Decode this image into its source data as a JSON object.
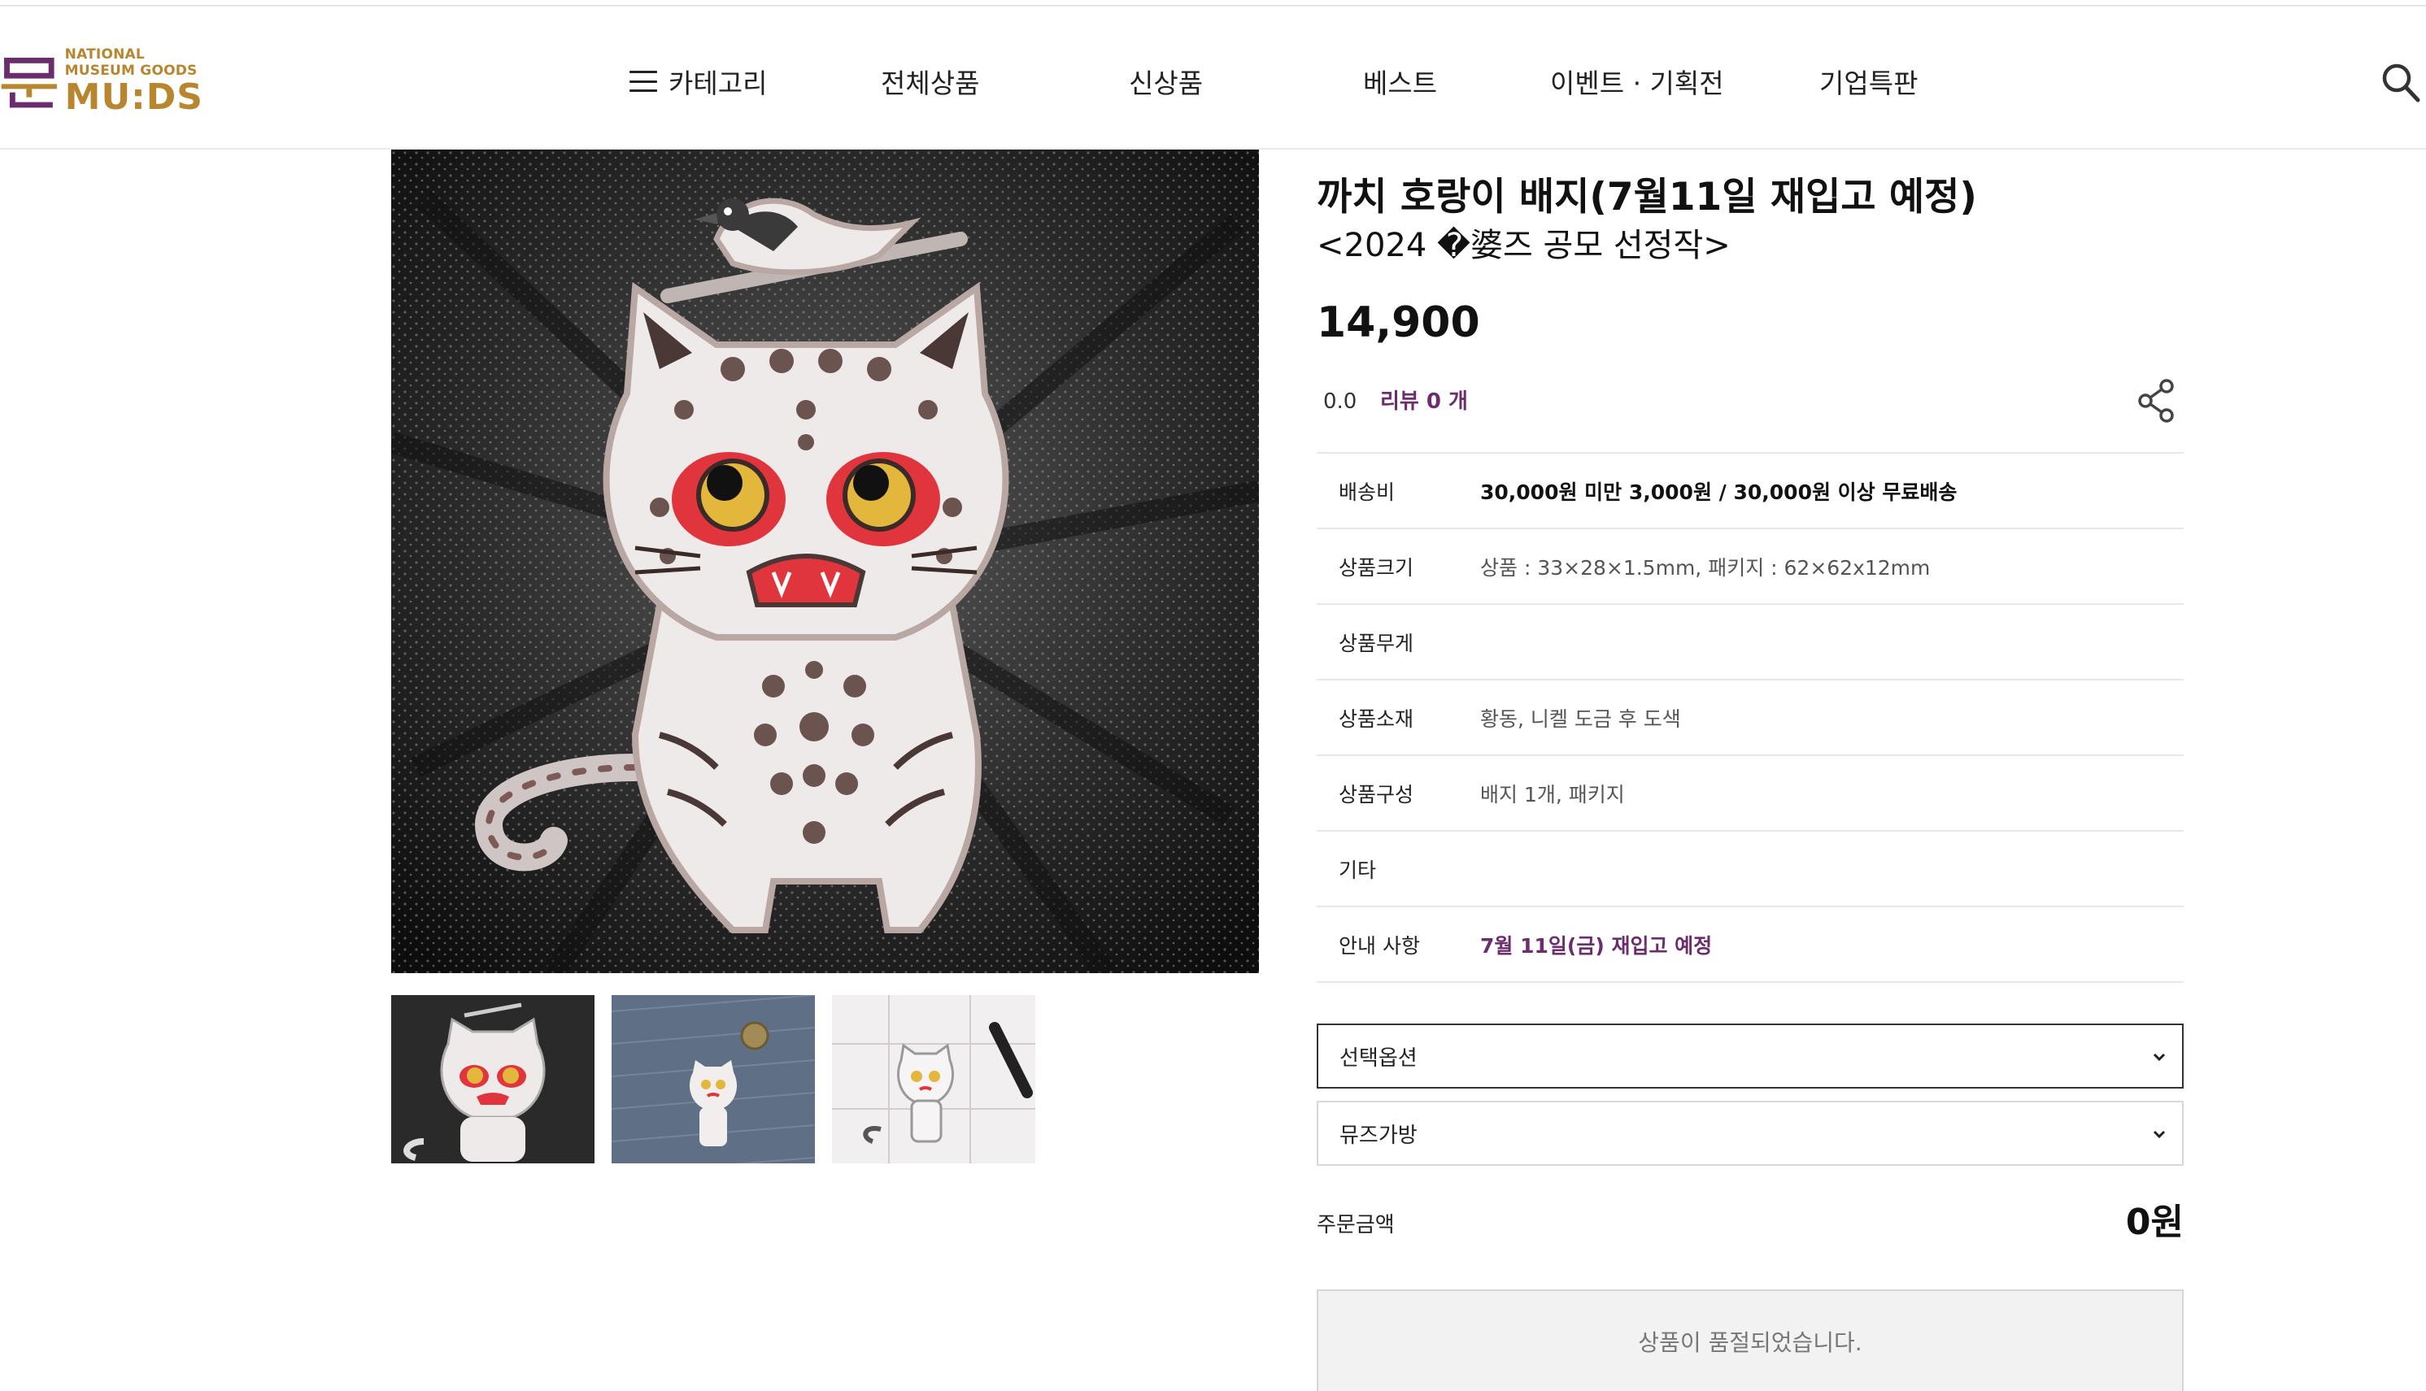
{
  "brand": {
    "logo_sub_line1": "NATIONAL",
    "logo_sub_line2": "MUSEUM GOODS",
    "logo_main": "MU:DS",
    "accent_color": "#b8862e",
    "mark_color": "#6b2d6e"
  },
  "nav": {
    "items": [
      {
        "label": "카테고리",
        "icon": "hamburger-icon"
      },
      {
        "label": "전체상품"
      },
      {
        "label": "신상품"
      },
      {
        "label": "베스트"
      },
      {
        "label": "이벤트 · 기획전"
      },
      {
        "label": "기업특판"
      }
    ],
    "search_icon": "search-icon"
  },
  "gallery": {
    "thumbnails": [
      {
        "name": "thumbnail-badge-closeup"
      },
      {
        "name": "thumbnail-badge-on-denim"
      },
      {
        "name": "thumbnail-badge-on-calendar"
      }
    ]
  },
  "product": {
    "title": "까치 호랑이 배지(7월11일 재입고 예정)",
    "subtitle": "<2024 �婆즈 공모 선정작>",
    "price": "14,900",
    "rating": "0.0",
    "review_label": "리뷰 0 개",
    "share_icon": "share-icon",
    "specs": [
      {
        "label": "배송비",
        "value": "30,000원 미만 3,000원 / 30,000원 이상 무료배송",
        "style": "strong"
      },
      {
        "label": "상품크기",
        "value": "상품 : 33×28×1.5mm, 패키지 : 62×62x12mm",
        "style": "normal"
      },
      {
        "label": "상품무게",
        "value": "",
        "style": "normal"
      },
      {
        "label": "상품소재",
        "value": "황동, 니켈 도금 후 도색",
        "style": "normal"
      },
      {
        "label": "상품구성",
        "value": "배지 1개, 패키지",
        "style": "normal"
      },
      {
        "label": "기타",
        "value": "",
        "style": "normal"
      },
      {
        "label": "안내 사항",
        "value": "7월 11일(금) 재입고 예정",
        "style": "accent"
      }
    ],
    "option_select": "선택옵션",
    "bag_select": "뮤즈가방",
    "total_label": "주문금액",
    "total_value": "0원",
    "soldout_label": "상품이 품절되었습니다.",
    "accent_color": "#6b2d6e"
  }
}
